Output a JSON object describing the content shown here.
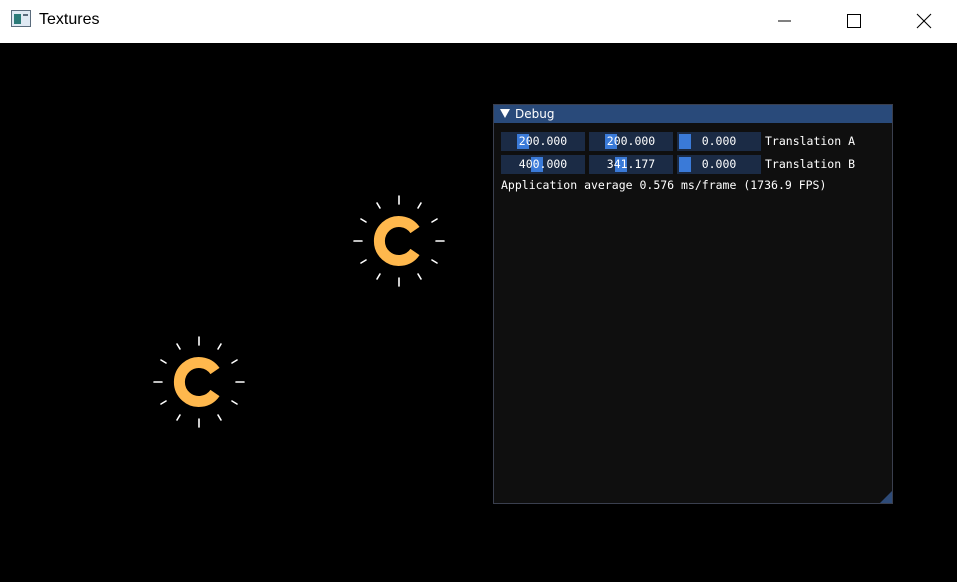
{
  "window": {
    "title": "Textures",
    "icon": "app-window-icon",
    "controls": [
      "minimize-icon",
      "maximize-icon",
      "close-icon"
    ]
  },
  "scene": {
    "background_color": "#000000",
    "sprites": [
      {
        "name": "logo-sprite-a",
        "icon": "sun-logo-c-icon",
        "color": "#ffb84d"
      },
      {
        "name": "logo-sprite-b",
        "icon": "sun-logo-c-icon",
        "color": "#ffb84d"
      }
    ]
  },
  "debug": {
    "title": "Debug",
    "accent_color": "#3a7ad8",
    "rows": [
      {
        "values": [
          "200.000",
          "200.000",
          "0.000"
        ],
        "label": "Translation A"
      },
      {
        "values": [
          "400.000",
          "341.177",
          "0.000"
        ],
        "label": "Translation B"
      }
    ],
    "stats": "Application average 0.576 ms/frame (1736.9 FPS)"
  }
}
